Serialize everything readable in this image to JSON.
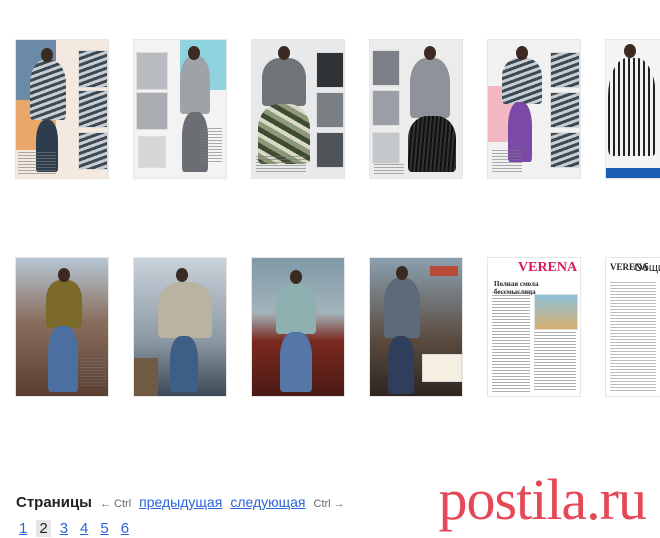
{
  "thumbnails_row1": [
    {
      "name": "magazine-page-1"
    },
    {
      "name": "magazine-page-2"
    },
    {
      "name": "magazine-page-3"
    },
    {
      "name": "magazine-page-4"
    },
    {
      "name": "magazine-page-5"
    },
    {
      "name": "magazine-page-6"
    }
  ],
  "thumbnails_row2": [
    {
      "name": "magazine-page-7"
    },
    {
      "name": "magazine-page-8"
    },
    {
      "name": "magazine-page-9"
    },
    {
      "name": "magazine-page-10"
    },
    {
      "name": "magazine-page-11",
      "logo": "VERENA",
      "heading": "Полная смола бессмыслица"
    },
    {
      "name": "magazine-page-12",
      "logo": "VERENA",
      "heading": "Общие"
    }
  ],
  "pager": {
    "title": "Страницы",
    "prev_hint": "← Ctrl",
    "prev_label": "предыдущая",
    "next_label": "следующая",
    "next_hint": "Ctrl →",
    "pages": [
      "1",
      "2",
      "3",
      "4",
      "5",
      "6"
    ],
    "current": "2"
  },
  "watermark": "postila.ru",
  "colors": {
    "link": "#2a64d8",
    "watermark": "#e33a4a",
    "verena": "#d81c5a"
  }
}
